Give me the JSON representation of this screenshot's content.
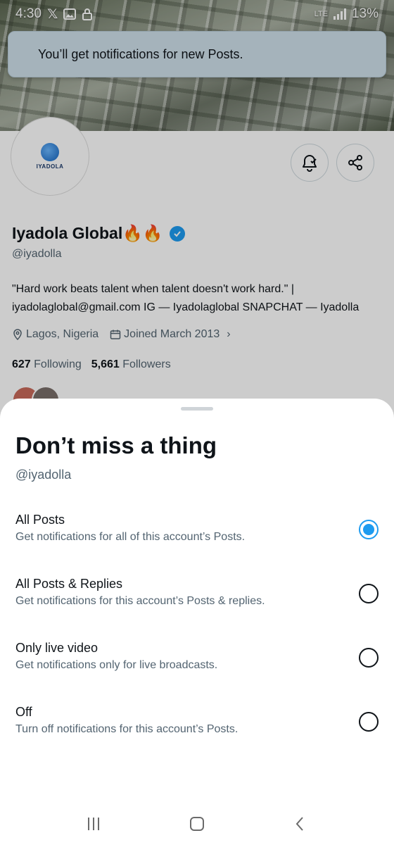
{
  "status_bar": {
    "time": "4:30",
    "network": "LTE",
    "battery": "13%"
  },
  "toast": {
    "message": "You’ll get notifications for new Posts."
  },
  "profile": {
    "avatar_logo_text": "IYADOLA",
    "name": "Iyadola Global🔥🔥",
    "handle": "@iyadolla",
    "bio_line1": "\"Hard work beats talent when talent doesn't work hard.\" |",
    "bio_line2": "iyadolaglobal@gmail.com IG — Iyadolaglobal   SNAPCHAT — Iyadolla",
    "location": "Lagos, Nigeria",
    "joined": "Joined March 2013",
    "following_count": "627",
    "following_label": "Following",
    "followers_count": "5,661",
    "followers_label": "Followers"
  },
  "sheet": {
    "title": "Don’t miss a thing",
    "handle": "@iyadolla",
    "options": [
      {
        "label": "All Posts",
        "desc": "Get notifications for all of this account’s Posts.",
        "selected": true
      },
      {
        "label": "All Posts & Replies",
        "desc": "Get notifications for this account’s Posts & replies.",
        "selected": false
      },
      {
        "label": "Only live video",
        "desc": "Get notifications only for live broadcasts.",
        "selected": false
      },
      {
        "label": "Off",
        "desc": "Turn off notifications for this account’s Posts.",
        "selected": false
      }
    ]
  },
  "colors": {
    "accent": "#1d9bf0",
    "text": "#0f1419",
    "secondary_text": "#536471",
    "toast_bg": "#cfe0ea"
  },
  "icons": {
    "notify_button": "bell-check-icon",
    "share_button": "share-icon",
    "location": "location-pin-icon",
    "joined": "calendar-icon",
    "nav_recents": "recents-icon",
    "nav_home": "home-icon",
    "nav_back": "back-icon"
  }
}
